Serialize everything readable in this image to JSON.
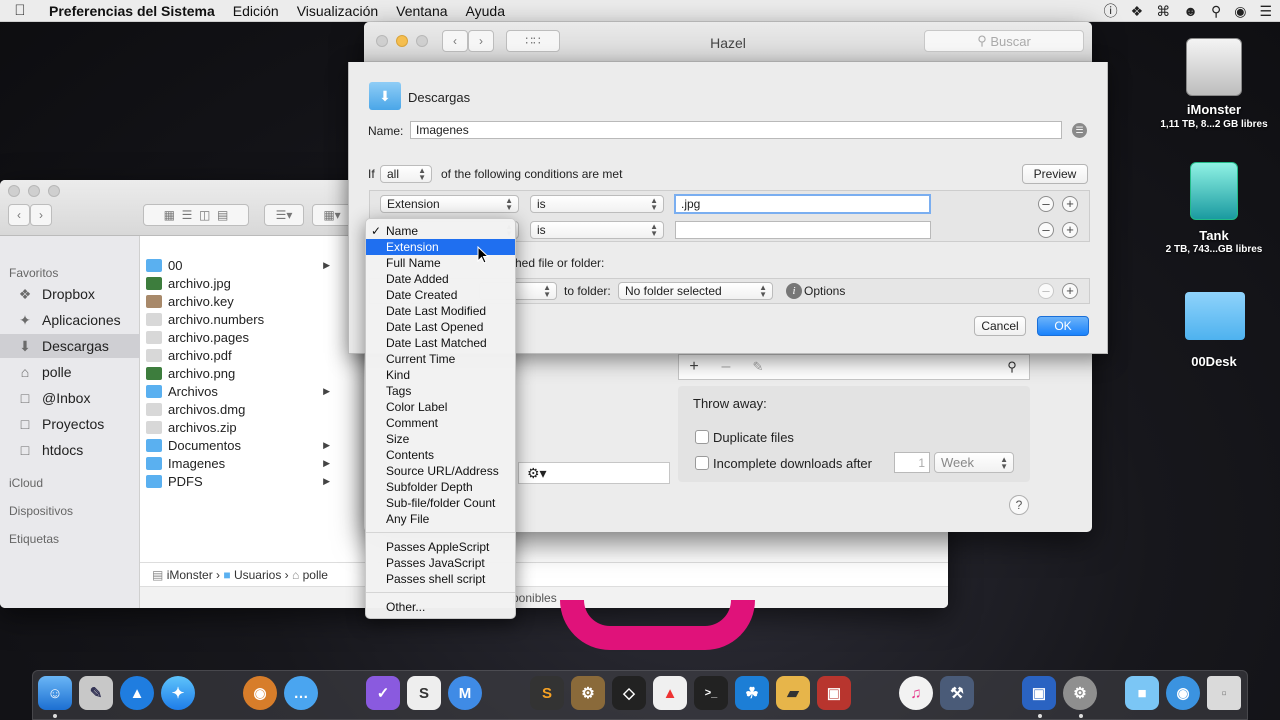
{
  "menubar": {
    "items": [
      "Preferencias del Sistema",
      "Edición",
      "Visualización",
      "Ventana",
      "Ayuda"
    ]
  },
  "finder": {
    "sidebar": {
      "favorites_header": "Favoritos",
      "items": [
        {
          "label": "Dropbox",
          "icon": "dropbox-icon"
        },
        {
          "label": "Aplicaciones",
          "icon": "applications-icon"
        },
        {
          "label": "Descargas",
          "icon": "downloads-icon",
          "selected": true
        },
        {
          "label": "polle",
          "icon": "home-icon"
        },
        {
          "label": "@Inbox",
          "icon": "folder-icon"
        },
        {
          "label": "Proyectos",
          "icon": "folder-icon"
        },
        {
          "label": "htdocs",
          "icon": "folder-icon"
        }
      ],
      "icloud_header": "iCloud",
      "devices_header": "Dispositivos",
      "tags_header": "Etiquetas"
    },
    "files": [
      {
        "name": "00",
        "type": "folder",
        "has_children": true
      },
      {
        "name": "archivo.jpg",
        "type": "image"
      },
      {
        "name": "archivo.key",
        "type": "key"
      },
      {
        "name": "archivo.numbers",
        "type": "doc"
      },
      {
        "name": "archivo.pages",
        "type": "doc"
      },
      {
        "name": "archivo.pdf",
        "type": "doc"
      },
      {
        "name": "archivo.png",
        "type": "image"
      },
      {
        "name": "Archivos",
        "type": "folder",
        "has_children": true
      },
      {
        "name": "archivos.dmg",
        "type": "doc"
      },
      {
        "name": "archivos.zip",
        "type": "doc"
      },
      {
        "name": "Documentos",
        "type": "folder",
        "has_children": true
      },
      {
        "name": "Imagenes",
        "type": "folder",
        "has_children": true
      },
      {
        "name": "PDFS",
        "type": "folder",
        "has_children": true
      }
    ],
    "path": [
      "iMonster",
      "Usuarios",
      "polle"
    ],
    "status": "ponibles"
  },
  "hazel": {
    "title": "Hazel",
    "search_placeholder": "Buscar",
    "sheet": {
      "folder_name": "Descargas",
      "name_label": "Name:",
      "name_value": "Imagenes",
      "if_label": "If",
      "match_value": "all",
      "conditions_text": "of the following conditions are met",
      "preview_label": "Preview",
      "cond1_attr": "Extension",
      "cond1_op": "is",
      "cond1_value": ".jpg",
      "cond2_op": "is",
      "do_text_fragment": "hed file or folder:",
      "to_folder_label": "to folder:",
      "to_folder_value": "No folder selected",
      "options_label": "Options",
      "cancel_label": "Cancel",
      "ok_label": "OK"
    },
    "throw_away_label": "Throw away:",
    "duplicate_label": "Duplicate files",
    "incomplete_label": "Incomplete downloads after",
    "incomplete_value": "1",
    "incomplete_unit": "Week"
  },
  "dropdown": {
    "checked_item": "Name",
    "highlighted_item": "Extension",
    "group1": [
      "Name",
      "Extension",
      "Full Name",
      "Date Added",
      "Date Created",
      "Date Last Modified",
      "Date Last Opened",
      "Date Last Matched",
      "Current Time",
      "Kind",
      "Tags",
      "Color Label",
      "Comment",
      "Size",
      "Contents",
      "Source URL/Address",
      "Subfolder Depth",
      "Sub-file/folder Count",
      "Any File"
    ],
    "group2": [
      "Passes AppleScript",
      "Passes JavaScript",
      "Passes shell script"
    ],
    "other": "Other..."
  },
  "desktop": [
    {
      "name": "iMonster",
      "detail": "1,11 TB, 8...2 GB libres"
    },
    {
      "name": "Tank",
      "detail": "2 TB, 743...GB libres"
    },
    {
      "name": "00Desk",
      "detail": ""
    }
  ],
  "accent_color": "#1f6ff0"
}
